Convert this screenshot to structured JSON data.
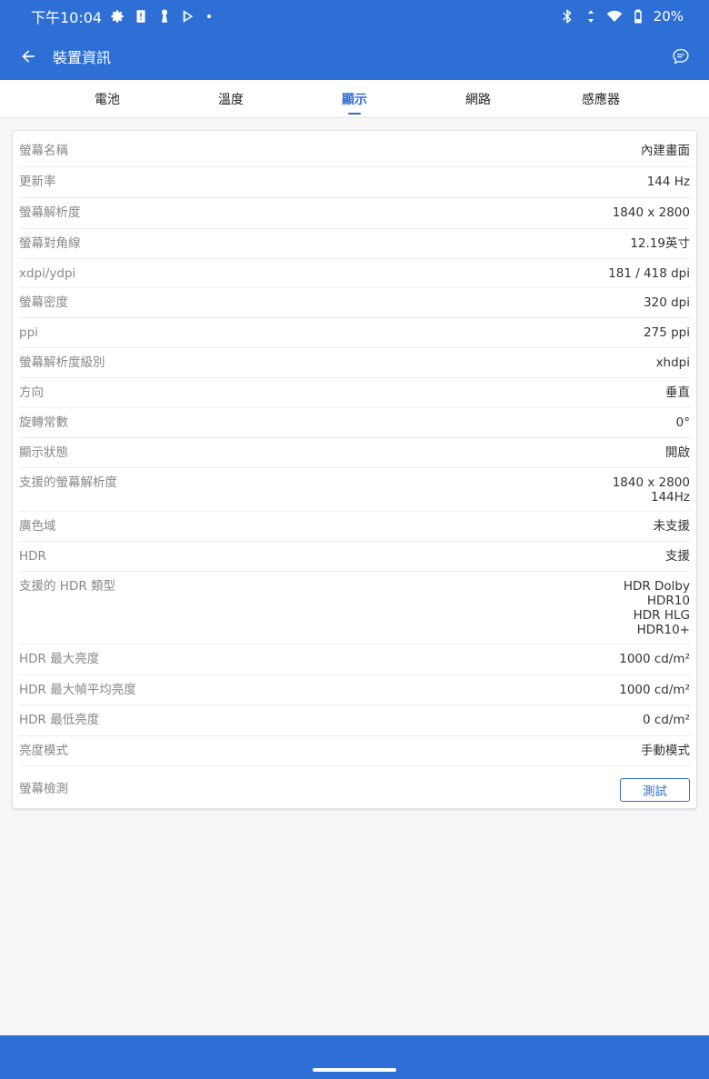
{
  "status_bar": {
    "time": "下午10:04",
    "battery": "20%",
    "icons": [
      "gear-icon",
      "alert-icon",
      "keyhole-icon",
      "play-store-icon",
      "bluetooth-icon",
      "data-arrows-icon",
      "wifi-icon",
      "battery-icon"
    ]
  },
  "app_bar": {
    "title": "裝置資訊",
    "back_icon": "arrow-left-icon",
    "feedback_icon": "chat-bubble-icon"
  },
  "tabs": [
    {
      "label": "電池",
      "active": false
    },
    {
      "label": "溫度",
      "active": false
    },
    {
      "label": "顯示",
      "active": true
    },
    {
      "label": "網路",
      "active": false
    },
    {
      "label": "感應器",
      "active": false
    }
  ],
  "rows": [
    {
      "label": "螢幕名稱",
      "value": [
        "內建畫面"
      ]
    },
    {
      "label": "更新率",
      "value": [
        "144 Hz"
      ]
    },
    {
      "label": "螢幕解析度",
      "value": [
        "1840 x 2800"
      ]
    },
    {
      "label": "螢幕對角線",
      "value": [
        "12.19英寸"
      ]
    },
    {
      "label": "xdpi/ydpi",
      "value": [
        "181 / 418 dpi"
      ]
    },
    {
      "label": "螢幕密度",
      "value": [
        "320 dpi"
      ]
    },
    {
      "label": "ppi",
      "value": [
        "275 ppi"
      ]
    },
    {
      "label": "螢幕解析度級別",
      "value": [
        "xhdpi"
      ]
    },
    {
      "label": "方向",
      "value": [
        "垂直"
      ]
    },
    {
      "label": "旋轉常數",
      "value": [
        "0°"
      ]
    },
    {
      "label": "顯示狀態",
      "value": [
        "開啟"
      ]
    },
    {
      "label": "支援的螢幕解析度",
      "value": [
        "1840 x 2800",
        "144Hz"
      ]
    },
    {
      "label": "廣色域",
      "value": [
        "未支援"
      ]
    },
    {
      "label": "HDR",
      "value": [
        "支援"
      ]
    },
    {
      "label": "支援的 HDR 類型",
      "value": [
        "HDR Dolby",
        "HDR10",
        "HDR HLG",
        "HDR10+"
      ]
    },
    {
      "label": "HDR 最大亮度",
      "value": [
        "1000 cd/m²"
      ]
    },
    {
      "label": "HDR 最大幀平均亮度",
      "value": [
        "1000 cd/m²"
      ]
    },
    {
      "label": "HDR 最低亮度",
      "value": [
        "0 cd/m²"
      ]
    },
    {
      "label": "亮度模式",
      "value": [
        "手動模式"
      ]
    }
  ],
  "test_row": {
    "label": "螢幕檢測",
    "button_label": "測試"
  },
  "colors": {
    "primary": "#2e6fd6",
    "label_text": "#888888",
    "value_text": "#333333"
  }
}
